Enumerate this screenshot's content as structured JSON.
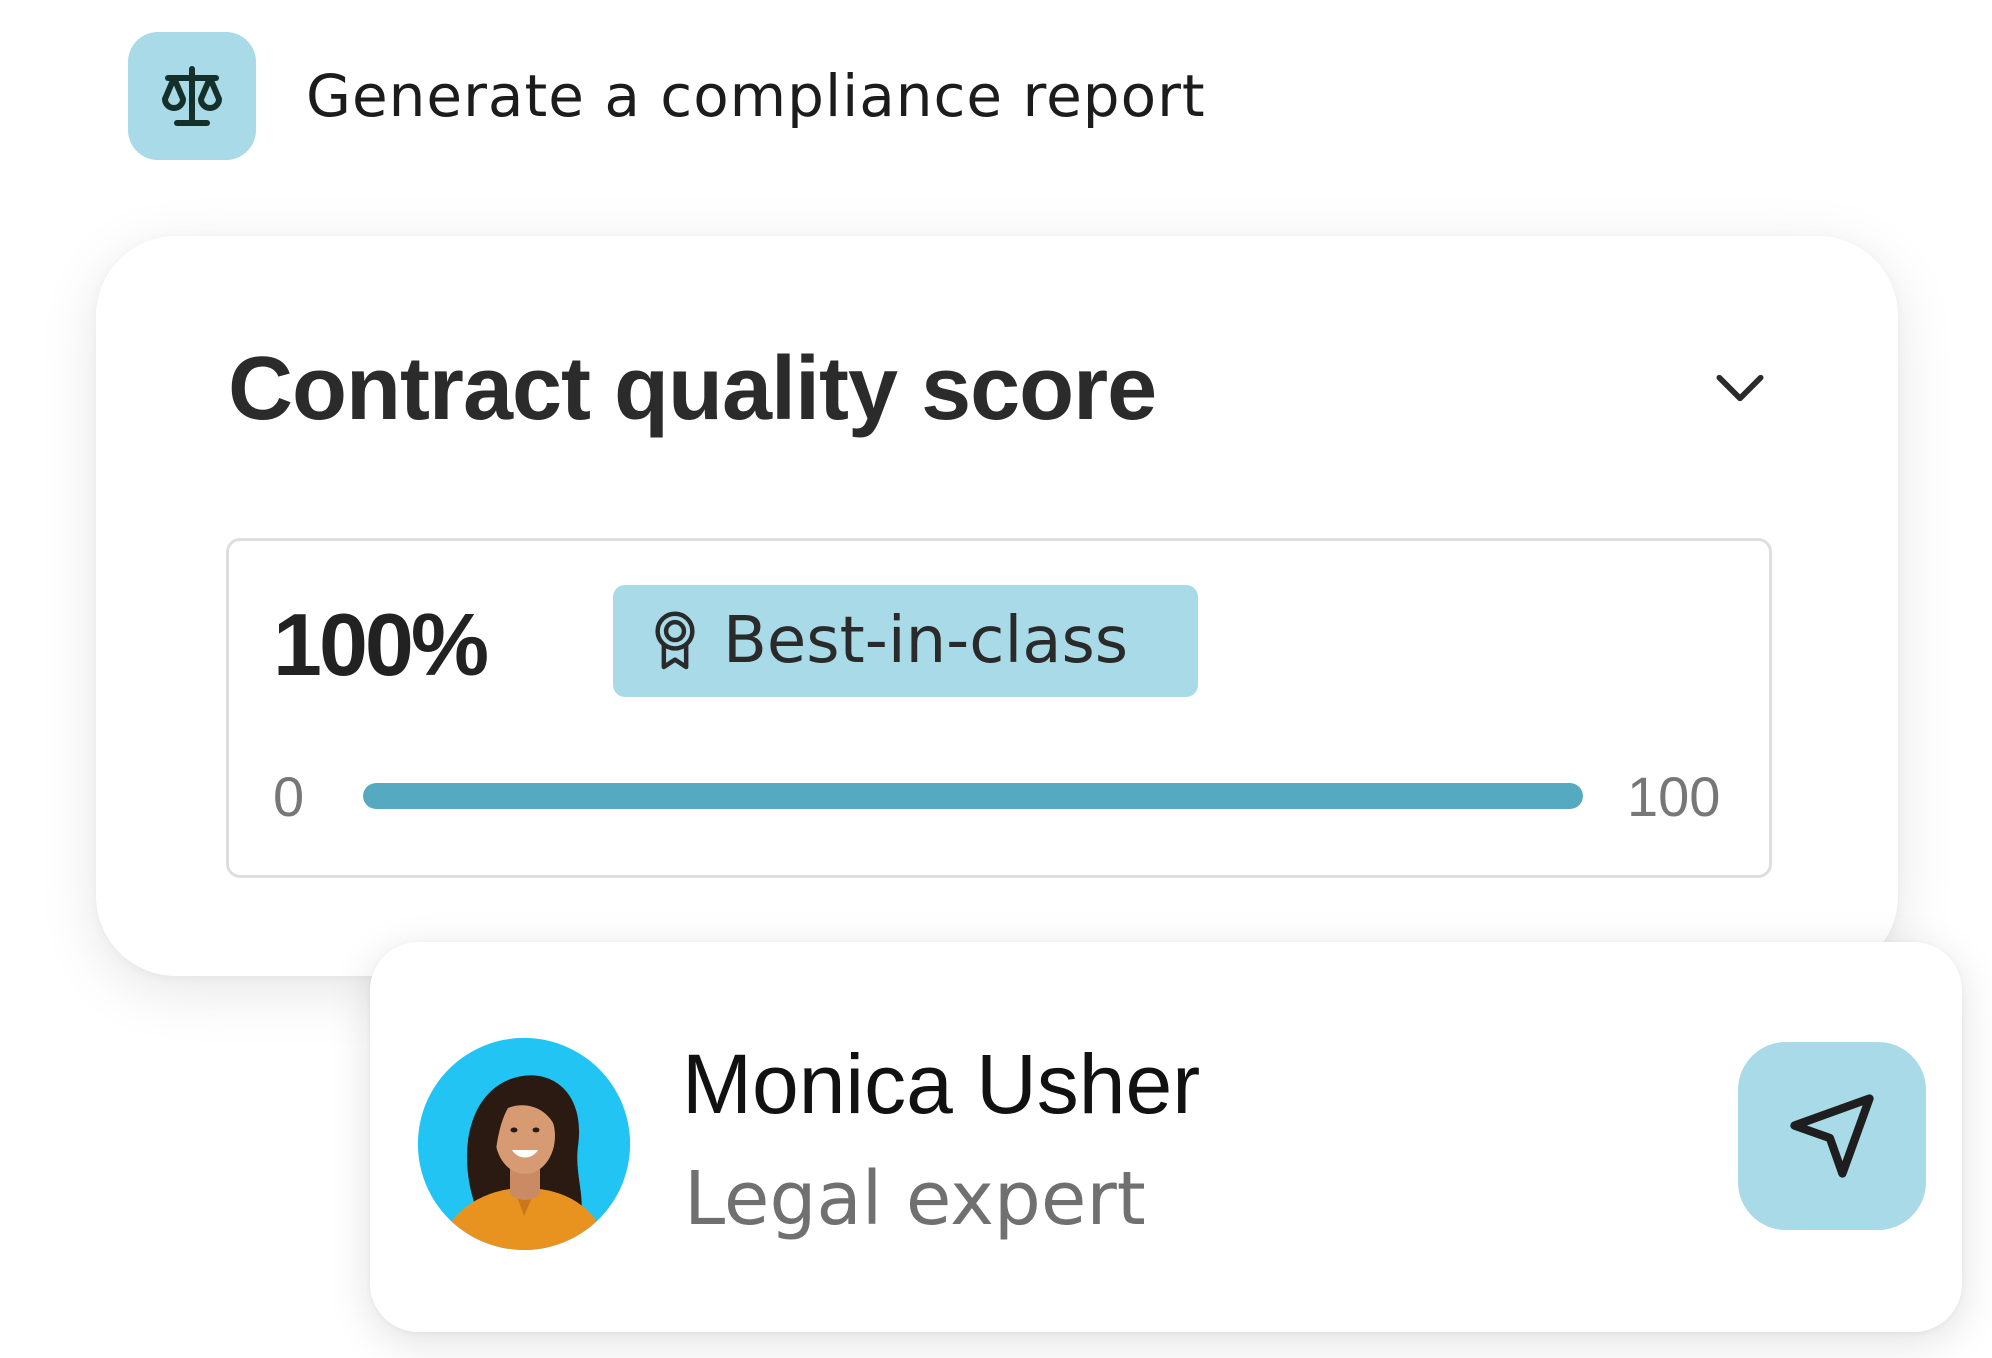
{
  "action": {
    "icon": "scale-icon",
    "label": "Generate a compliance report"
  },
  "score_card": {
    "title": "Contract quality score",
    "collapse_icon": "chevron-down-icon",
    "score_value": "100%",
    "badge": {
      "icon": "award-ribbon-icon",
      "label": "Best-in-class"
    },
    "range_min": "0",
    "range_max": "100",
    "progress_fraction": 1.0
  },
  "expert": {
    "name": "Monica Usher",
    "role": "Legal expert",
    "avatar": "avatar-photo",
    "send_icon": "send-arrow-icon"
  },
  "colors": {
    "accent_light": "#a8dae7",
    "progress": "#55a9c0",
    "avatar_bg": "#21c4f2"
  }
}
